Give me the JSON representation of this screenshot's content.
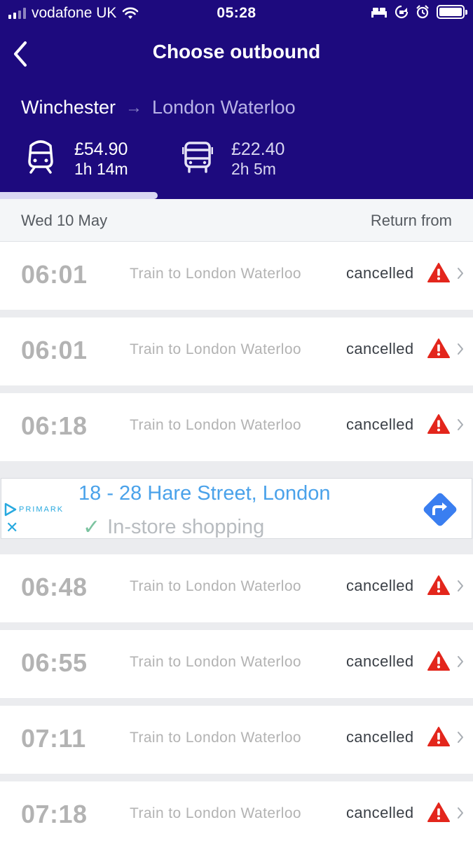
{
  "status_bar": {
    "carrier": "vodafone UK",
    "time": "05:28"
  },
  "header": {
    "title": "Choose outbound",
    "origin": "Winchester",
    "destination": "London Waterloo"
  },
  "modes": [
    {
      "icon": "train-icon",
      "price": "£54.90",
      "duration": "1h 14m",
      "selected": true
    },
    {
      "icon": "bus-icon",
      "price": "£22.40",
      "duration": "2h 5m",
      "selected": false
    }
  ],
  "date_bar": {
    "date": "Wed 10 May",
    "return_label": "Return from"
  },
  "journeys": [
    {
      "time": "06:01",
      "description": "Train to London Waterloo",
      "status": "cancelled"
    },
    {
      "time": "06:01",
      "description": "Train to London Waterloo",
      "status": "cancelled"
    },
    {
      "time": "06:18",
      "description": "Train to London Waterloo",
      "status": "cancelled"
    },
    {
      "time": "06:48",
      "description": "Train to London Waterloo",
      "status": "cancelled"
    },
    {
      "time": "06:55",
      "description": "Train to London Waterloo",
      "status": "cancelled"
    },
    {
      "time": "07:11",
      "description": "Train to London Waterloo",
      "status": "cancelled"
    },
    {
      "time": "07:18",
      "description": "Train to London Waterloo",
      "status": "cancelled"
    }
  ],
  "ad": {
    "brand": "PRIMARK",
    "address": "18 - 28 Hare Street, London",
    "feature": "In-store shopping",
    "close": "✕"
  },
  "colors": {
    "header_bg": "#1d0a7e",
    "warning": "#e3261c",
    "ad_accent": "#4aa2ea"
  }
}
